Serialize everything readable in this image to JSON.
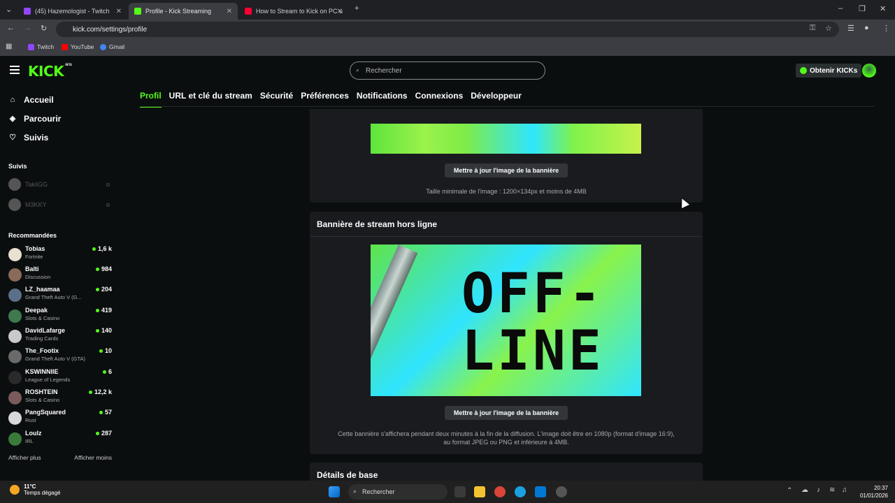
{
  "browser": {
    "tabs": [
      {
        "title": "(45) Hazemologist - Twitch",
        "color": "#9146ff",
        "active": false
      },
      {
        "title": "Profile - Kick Streaming",
        "color": "#53fc18",
        "active": true
      },
      {
        "title": "How to Stream to Kick on PC u",
        "color": "#ff0033",
        "active": false
      }
    ],
    "url": "kick.com/settings/profile",
    "bookmarks": [
      {
        "label": "Twitch",
        "color": "#9146ff"
      },
      {
        "label": "YouTube",
        "color": "#ff0000"
      },
      {
        "label": "Gmail",
        "color": "#4285f4"
      }
    ]
  },
  "header": {
    "logo": "KICK",
    "logo_badge": "BETA",
    "search_placeholder": "Rechercher",
    "kicks_button": "Obtenir KICKs"
  },
  "settings_tabs": [
    {
      "label": "Profil",
      "active": true
    },
    {
      "label": "URL et clé du stream",
      "active": false
    },
    {
      "label": "Sécurité",
      "active": false
    },
    {
      "label": "Préférences",
      "active": false
    },
    {
      "label": "Notifications",
      "active": false
    },
    {
      "label": "Connexions",
      "active": false
    },
    {
      "label": "Développeur",
      "active": false
    }
  ],
  "sidebar": {
    "nav": [
      {
        "label": "Accueil",
        "icon": "home-icon"
      },
      {
        "label": "Parcourir",
        "icon": "compass-icon"
      },
      {
        "label": "Suivis",
        "icon": "heart-icon"
      }
    ],
    "following_title": "Suivis",
    "following": [
      {
        "name": "TakiiGG"
      },
      {
        "name": "M3KKY"
      }
    ],
    "recommended_title": "Recommandées",
    "recommended": [
      {
        "name": "Tobias",
        "category": "Fortnite",
        "viewers": "1,6 k",
        "color": "#e8e0d0"
      },
      {
        "name": "Balti",
        "category": "Discussion",
        "viewers": "984",
        "color": "#8a6a58"
      },
      {
        "name": "LZ_haamaa",
        "category": "Grand Theft Auto V (G...",
        "viewers": "204",
        "color": "#5a6f8a"
      },
      {
        "name": "Deepak",
        "category": "Slots & Casino",
        "viewers": "419",
        "color": "#3f7a4f"
      },
      {
        "name": "DavidLafarge",
        "category": "Trading Cards",
        "viewers": "140",
        "color": "#c9c9c9"
      },
      {
        "name": "The_Footix",
        "category": "Grand Theft Auto V (GTA)",
        "viewers": "10",
        "color": "#6a6a6a"
      },
      {
        "name": "KSWINNIIE",
        "category": "League of Legends",
        "viewers": "6",
        "color": "#2a2a2a"
      },
      {
        "name": "ROSHTEIN",
        "category": "Slots & Casino",
        "viewers": "12,2 k",
        "color": "#7a5a5a"
      },
      {
        "name": "PangSquared",
        "category": "Rust",
        "viewers": "57",
        "color": "#d8d8d8"
      },
      {
        "name": "Loulz",
        "category": "IRL",
        "viewers": "287",
        "color": "#3a7a3a"
      }
    ],
    "show_more": "Afficher plus",
    "show_less": "Afficher moins"
  },
  "main": {
    "banner_update_button": "Mettre à jour l'image de la bannière",
    "banner_hint": "Taille minimale de l'image : 1200×134px et moins de 4MB",
    "offline_title": "Bannière de stream hors ligne",
    "offline_text_line1": "OFF-",
    "offline_text_line2": "LINE",
    "offline_update_button": "Mettre à jour l'image de la bannière",
    "offline_hint_1": "Cette bannière s'affichera pendant deux minutes à la fin de la diffusion. L'image doit être en 1080p (format d'image 16:9),",
    "offline_hint_2": "au format JPEG ou PNG et inférieure à 4MB.",
    "details_title": "Détails de base"
  },
  "taskbar": {
    "temperature": "11°C",
    "weather": "Temps dégagé",
    "search": "Rechercher",
    "time": "20:37",
    "date": "01/01/2026"
  }
}
